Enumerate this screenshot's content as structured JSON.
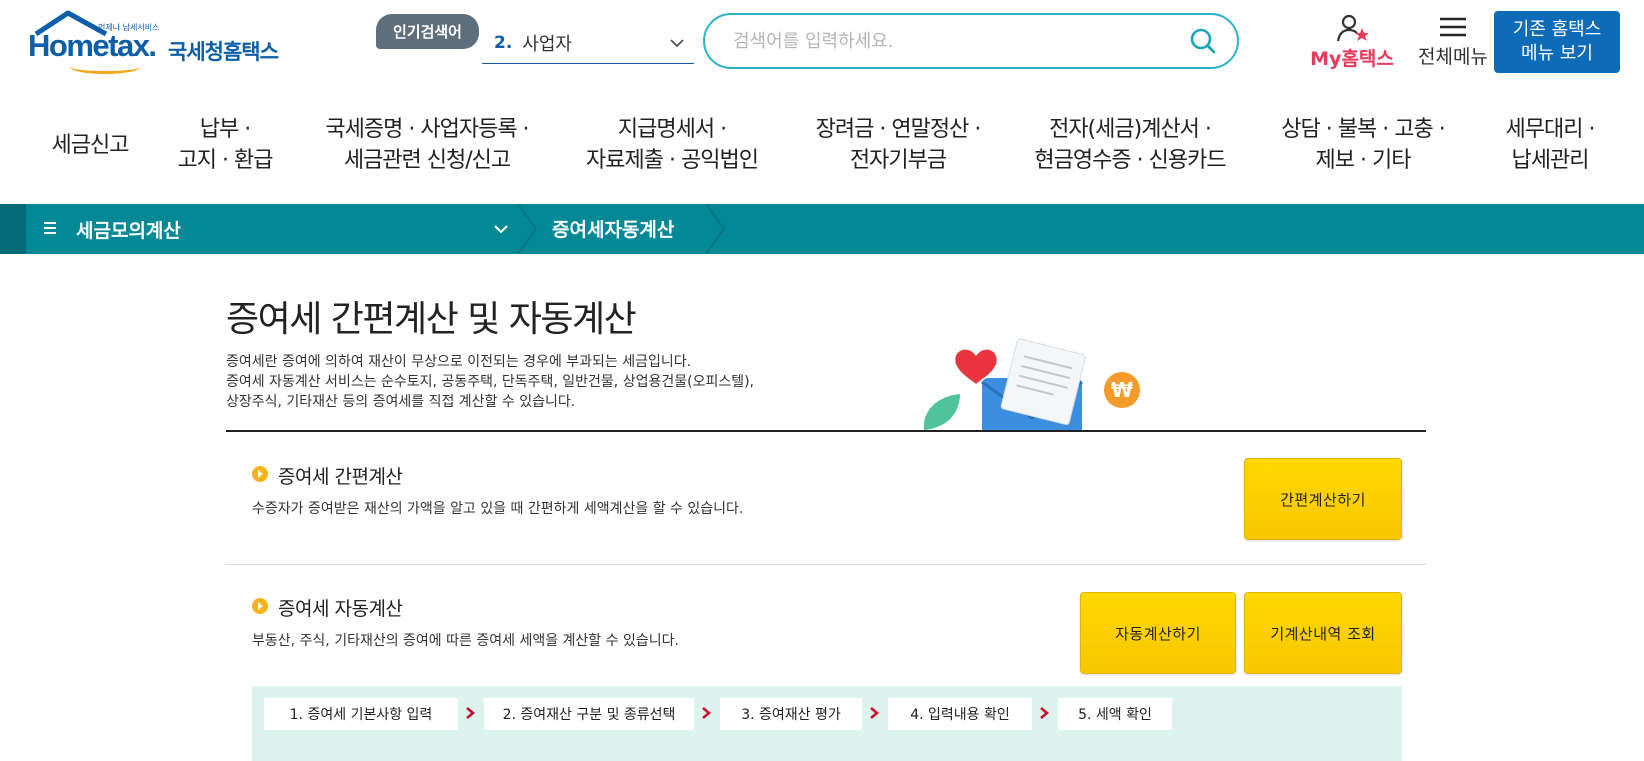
{
  "header": {
    "logo": {
      "tagline": "언제나 납세서비스",
      "brand_en": "Hometax.",
      "brand_ko": "국세청홈택스"
    },
    "popular_search": {
      "badge": "인기검색어",
      "rank": "2.",
      "keyword": "사업자"
    },
    "search": {
      "placeholder": "검색어를 입력하세요."
    },
    "my_hometax": "My홈택스",
    "all_menu": "전체메뉴",
    "legacy_button": {
      "line1": "기존 홈택스",
      "line2": "메뉴 보기"
    }
  },
  "gnb": [
    {
      "label": "세금신고"
    },
    {
      "label": "납부 ·\n고지 · 환급"
    },
    {
      "label": "국세증명 · 사업자등록 ·\n세금관련 신청/신고"
    },
    {
      "label": "지급명세서 ·\n자료제출 · 공익법인"
    },
    {
      "label": "장려금 · 연말정산 ·\n전자기부금"
    },
    {
      "label": "전자(세금)계산서 ·\n현금영수증 · 신용카드"
    },
    {
      "label": "상담 · 불복 · 고충 ·\n제보 · 기타"
    },
    {
      "label": "세무대리 ·\n납세관리"
    }
  ],
  "location": {
    "first": "세금모의계산",
    "second": "증여세자동계산"
  },
  "page": {
    "title": "증여세 간편계산 및 자동계산",
    "intro": [
      "증여세란 증여에 의하여 재산이 무상으로 이전되는 경우에 부과되는 세금입니다.",
      "증여세 자동계산 서비스는 순수토지, 공동주택, 단독주택, 일반건물, 상업용건물(오피스텔),",
      "상장주식, 기타재산 등의 증여세를 직접 계산할 수 있습니다."
    ]
  },
  "simple_calc": {
    "title": "증여세 간편계산",
    "desc": "수증자가 증여받은 재산의 가액을 알고 있을 때 간편하게 세액계산을 할 수 있습니다.",
    "button": "간편계산하기"
  },
  "auto_calc": {
    "title": "증여세 자동계산",
    "desc": "부동산, 주식, 기타재산의 증여에 따른 증여세 세액을 계산할 수 있습니다.",
    "button": "자동계산하기",
    "history_button": "기계산내역 조회",
    "steps": [
      "1. 증여세 기본사항 입력",
      "2. 증여재산 구분 및 종류선택",
      "3. 증여재산 평가",
      "4. 입력내용 확인",
      "5. 세액 확인"
    ]
  },
  "colors": {
    "brand_blue": "#0d5ea8",
    "location_teal": "#038896",
    "search_border": "#29b3c5",
    "accent_pink": "#e8395d",
    "button_yellow": "#ffd400",
    "step_bg": "#dcf3ee",
    "step_arrow": "#c8102e"
  }
}
